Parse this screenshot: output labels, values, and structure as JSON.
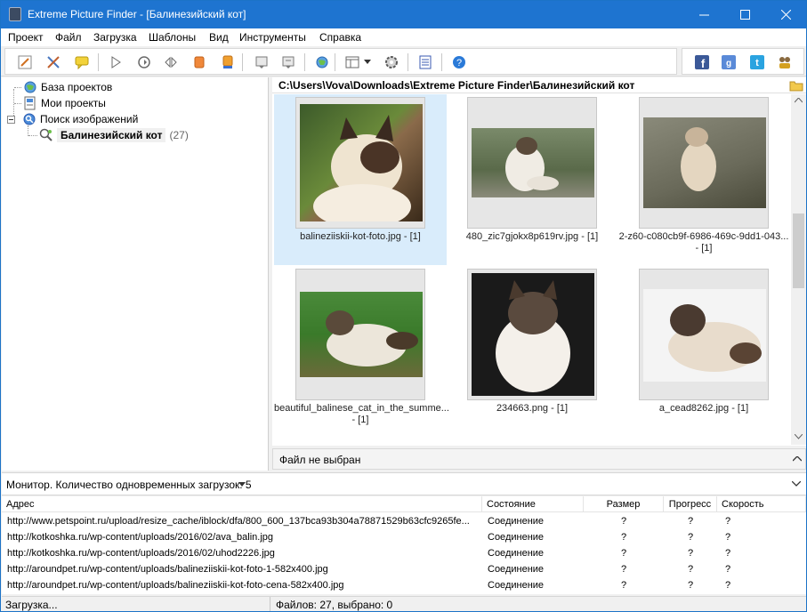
{
  "window": {
    "title": "Extreme Picture Finder - [Балинезийский кот]"
  },
  "menu": [
    "Проект",
    "Файл",
    "Загрузка",
    "Шаблоны",
    "Вид",
    "Инструменты",
    "Справка"
  ],
  "tree": {
    "items": [
      {
        "label": "База проектов",
        "icon": "database-icon"
      },
      {
        "label": "Мои проекты",
        "icon": "projects-icon"
      },
      {
        "label": "Поиск изображений",
        "icon": "search-icon"
      },
      {
        "label": "Балинезийский кот",
        "count": "(27)",
        "icon": "search-icon"
      }
    ]
  },
  "path": "C:\\Users\\Vova\\Downloads\\Extreme Picture Finder\\Балинезийский кот",
  "thumbnails": [
    {
      "caption": "balineziiskii-kot-foto.jpg - [1]"
    },
    {
      "caption": "480_zic7gjokx8p619rv.jpg - [1]"
    },
    {
      "caption": "2-z60-c080cb9f-6986-469c-9dd1-043...",
      "caption2": "- [1]"
    },
    {
      "caption": "beautiful_balinese_cat_in_the_summe...",
      "caption2": "- [1]"
    },
    {
      "caption": "234663.png - [1]"
    },
    {
      "caption": "a_cead8262.jpg - [1]"
    }
  ],
  "file_status": "Файл не выбран",
  "monitor": "Монитор. Количество одновременных загрузок: 5",
  "table": {
    "columns": [
      "Адрес",
      "Состояние",
      "Размер",
      "Прогресс",
      "Скорость"
    ],
    "rows": [
      {
        "url": "http://www.petspoint.ru/upload/resize_cache/iblock/dfa/800_600_137bca93b304a78871529b63cfc9265fe...",
        "state": "Соединение",
        "size": "?",
        "progress": "?",
        "speed": "?"
      },
      {
        "url": "http://kotkoshka.ru/wp-content/uploads/2016/02/ava_balin.jpg",
        "state": "Соединение",
        "size": "?",
        "progress": "?",
        "speed": "?"
      },
      {
        "url": "http://kotkoshka.ru/wp-content/uploads/2016/02/uhod2226.jpg",
        "state": "Соединение",
        "size": "?",
        "progress": "?",
        "speed": "?"
      },
      {
        "url": "http://aroundpet.ru/wp-content/uploads/balineziiskii-kot-foto-1-582x400.jpg",
        "state": "Соединение",
        "size": "?",
        "progress": "?",
        "speed": "?"
      },
      {
        "url": "http://aroundpet.ru/wp-content/uploads/balineziiskii-kot-foto-cena-582x400.jpg",
        "state": "Соединение",
        "size": "?",
        "progress": "?",
        "speed": "?"
      }
    ]
  },
  "status": {
    "left": "Загрузка...",
    "right": "Файлов: 27, выбрано: 0"
  },
  "colors": {
    "titlebar": "#1e74d0",
    "selection": "#d9ecfb"
  }
}
